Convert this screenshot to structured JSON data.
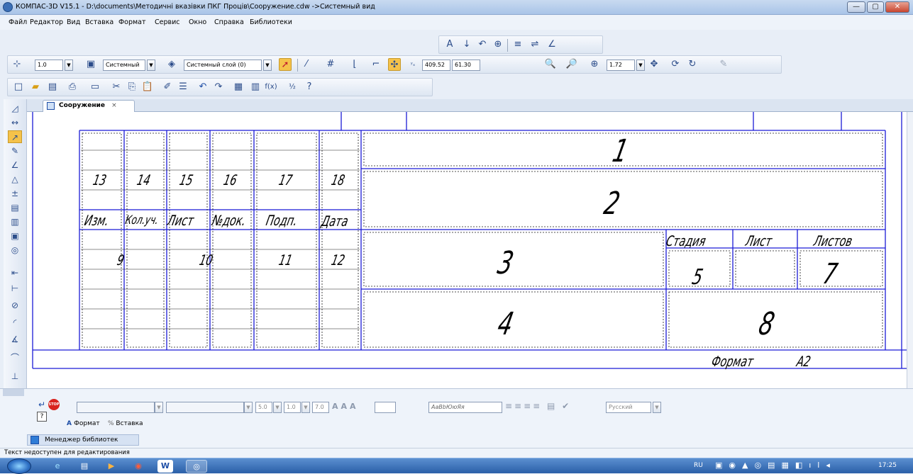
{
  "window": {
    "title": "КОМПАС-3D V15.1 - D:\\documents\\Методичні вказівки ПКГ Проців\\Сооружение.cdw ->Системный вид",
    "minimize": "—",
    "maximize": "▢",
    "close": "✕"
  },
  "menu": [
    "Файл",
    "Редактор",
    "Вид",
    "Вставка",
    "Формат",
    "Сервис",
    "Окно",
    "Справка",
    "Библиотеки"
  ],
  "toolbar": {
    "scale_value": "1.0",
    "style_value": "Системный",
    "layer_value": "Системный слой (0)",
    "coord_x": "409.52",
    "coord_y": "61.30",
    "zoom_value": "1.72"
  },
  "document_tab": {
    "label": "Сооружение",
    "close": "×"
  },
  "title_block": {
    "field_1": "1",
    "field_2": "2",
    "field_3": "3",
    "field_4": "4",
    "field_5": "5",
    "field_7": "7",
    "field_8": "8",
    "col_nums": [
      "13",
      "14",
      "15",
      "16",
      "17",
      "18"
    ],
    "col_heads": [
      "Изм.",
      "Кол.уч.",
      "Лист",
      "№док.",
      "Подп.",
      "Дата"
    ],
    "row_nums": [
      "9",
      "10",
      "11",
      "12"
    ],
    "stage_head": "Стадия",
    "sheet_head": "Лист",
    "sheets_head": "Листов",
    "format_label": "Формат",
    "format_value": "А2"
  },
  "text_toolbar": {
    "font_size": "5.0",
    "spacing": "1.0",
    "height": "7.0",
    "sample": "АаBbЮюЯя",
    "language": "Русский",
    "tab_format": "Формат",
    "tab_insert": "Вставка"
  },
  "library_manager": "Менеджер библиотек",
  "status_text": "Текст недоступен для редактирования",
  "tray": {
    "lang": "RU",
    "time": "17:25"
  }
}
